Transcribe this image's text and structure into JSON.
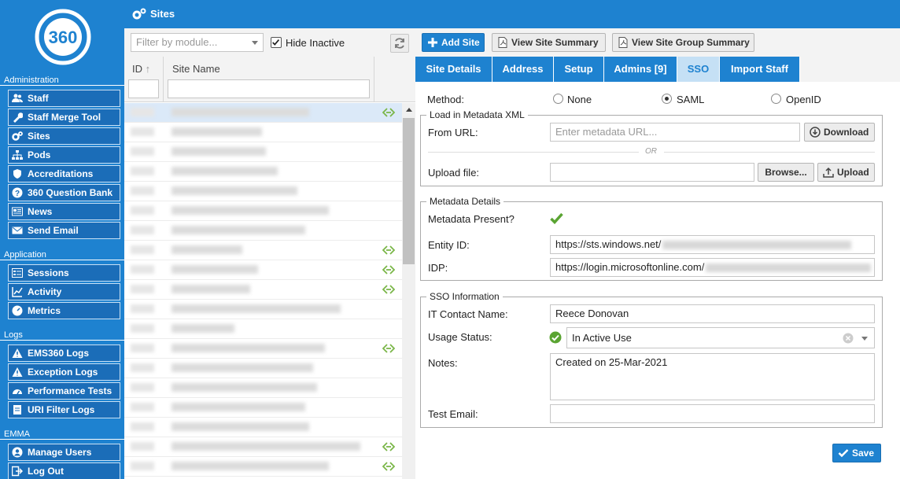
{
  "app": {
    "page_title": "Sites"
  },
  "sidebar": {
    "sections": [
      {
        "heading": "Administration",
        "items": [
          {
            "label": "Staff",
            "icon": "users-icon"
          },
          {
            "label": "Staff Merge Tool",
            "icon": "wrench-icon"
          },
          {
            "label": "Sites",
            "icon": "gears-icon"
          },
          {
            "label": "Pods",
            "icon": "sitemap-icon"
          },
          {
            "label": "Accreditations",
            "icon": "shield-icon"
          },
          {
            "label": "360 Question Bank",
            "icon": "question-icon"
          },
          {
            "label": "News",
            "icon": "newspaper-icon"
          },
          {
            "label": "Send Email",
            "icon": "envelope-icon"
          }
        ]
      },
      {
        "heading": "Application",
        "items": [
          {
            "label": "Sessions",
            "icon": "list-icon"
          },
          {
            "label": "Activity",
            "icon": "chart-icon"
          },
          {
            "label": "Metrics",
            "icon": "gauge-icon"
          }
        ]
      },
      {
        "heading": "Logs",
        "items": [
          {
            "label": "EMS360 Logs",
            "icon": "warning-icon"
          },
          {
            "label": "Exception Logs",
            "icon": "warning-icon"
          },
          {
            "label": "Performance Tests",
            "icon": "dashboard-icon"
          },
          {
            "label": "URI Filter Logs",
            "icon": "filter-icon"
          }
        ]
      },
      {
        "heading": "EMMA",
        "items": [
          {
            "label": "Manage Users",
            "icon": "user-icon"
          },
          {
            "label": "Log Out",
            "icon": "logout-icon"
          }
        ]
      }
    ]
  },
  "list": {
    "filter_placeholder": "Filter by module...",
    "hide_inactive_label": "Hide Inactive",
    "hide_inactive_checked": true,
    "columns": {
      "id": "ID",
      "name": "Site Name"
    }
  },
  "toolbar": {
    "add_site": "Add Site",
    "view_site_summary": "View Site Summary",
    "view_site_group_summary": "View Site Group Summary"
  },
  "tabs": [
    {
      "label": "Site Details",
      "active": false
    },
    {
      "label": "Address",
      "active": false
    },
    {
      "label": "Setup",
      "active": false
    },
    {
      "label": "Admins [9]",
      "active": false
    },
    {
      "label": "SSO",
      "active": true
    },
    {
      "label": "Import Staff",
      "active": false
    }
  ],
  "sso": {
    "method_label": "Method:",
    "methods": [
      {
        "label": "None",
        "selected": false
      },
      {
        "label": "SAML",
        "selected": true
      },
      {
        "label": "OpenID",
        "selected": false
      }
    ],
    "load_xml": {
      "legend": "Load in Metadata XML",
      "from_url_label": "From URL:",
      "url_placeholder": "Enter metadata URL...",
      "download_label": "Download",
      "or_text": "OR",
      "upload_file_label": "Upload file:",
      "browse_label": "Browse...",
      "upload_label": "Upload"
    },
    "metadata": {
      "legend": "Metadata Details",
      "present_label": "Metadata Present?",
      "entity_id_label": "Entity ID:",
      "entity_id_value": "https://sts.windows.net/",
      "idp_label": "IDP:",
      "idp_value": "https://login.microsoftonline.com/"
    },
    "info": {
      "legend": "SSO Information",
      "it_contact_label": "IT Contact Name:",
      "it_contact_value": "Reece Donovan",
      "usage_status_label": "Usage Status:",
      "usage_status_value": "In Active Use",
      "notes_label": "Notes:",
      "notes_value": "Created on 25-Mar-2021",
      "test_email_label": "Test Email:",
      "test_email_value": ""
    },
    "save_label": "Save"
  },
  "colors": {
    "primary": "#1e82d0",
    "success": "#5aa432",
    "link_icon": "#7ab648"
  }
}
